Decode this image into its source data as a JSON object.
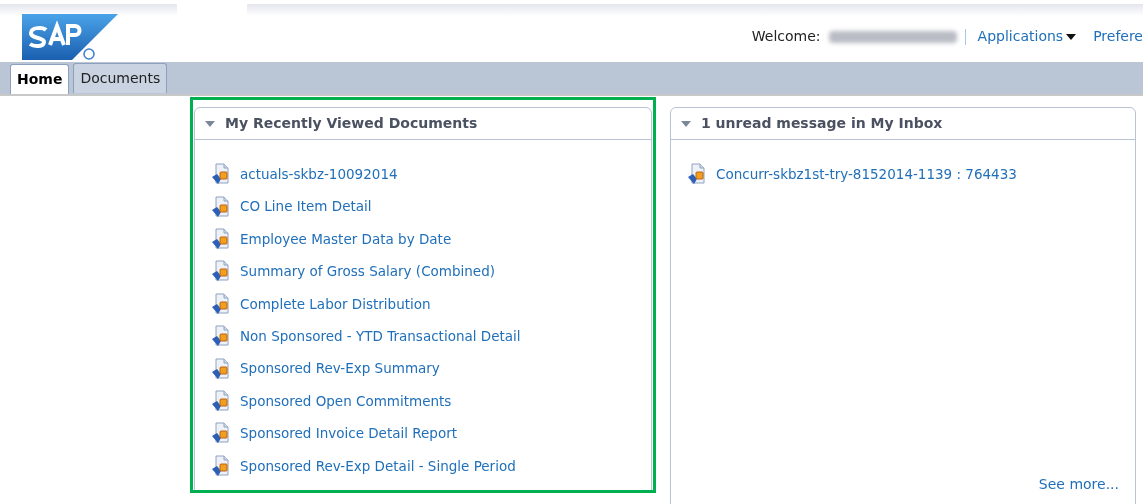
{
  "header": {
    "welcome_label": "Welcome:",
    "name_redacted": true,
    "links": [
      {
        "label": "Applications",
        "dropdown": true
      },
      {
        "label": "Prefere",
        "dropdown": false
      }
    ]
  },
  "tabs": [
    {
      "label": "Home",
      "selected": true
    },
    {
      "label": "Documents",
      "selected": false
    }
  ],
  "recent_documents": {
    "title": "My Recently Viewed Documents",
    "highlighted": true,
    "items": [
      "actuals-skbz-10092014",
      "CO Line Item Detail",
      "Employee Master Data by Date",
      "Summary of Gross Salary (Combined)",
      "Complete Labor Distribution",
      "Non Sponsored - YTD Transactional Detail",
      "Sponsored Rev-Exp Summary",
      "Sponsored Open Commitments",
      "Sponsored Invoice Detail Report",
      "Sponsored Rev-Exp Detail - Single Period"
    ]
  },
  "inbox": {
    "title": "1 unread message in My Inbox",
    "items": [
      "Concurr-skbz1st-try-8152014-1139 : 764433"
    ],
    "see_more": "See more..."
  }
}
